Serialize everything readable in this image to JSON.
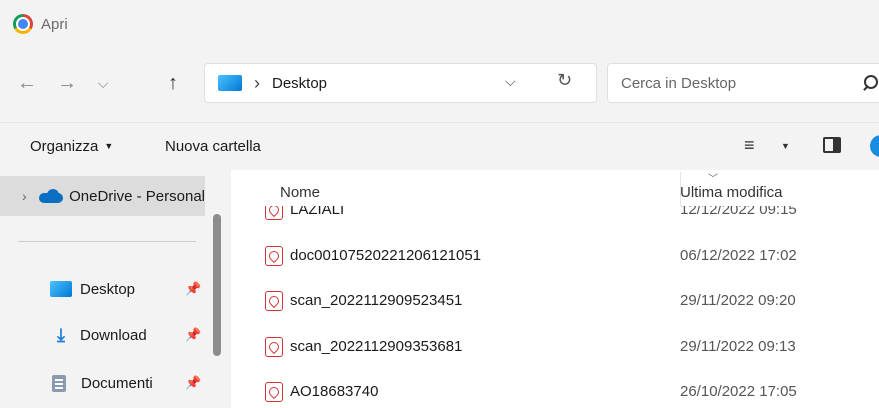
{
  "window": {
    "title": "Apri",
    "app_icon": "chrome-logo-icon"
  },
  "nav": {
    "back_icon": "arrow-left-icon",
    "forward_icon": "arrow-right-icon",
    "recent_icon": "chevron-down-icon",
    "up_icon": "arrow-up-icon"
  },
  "address": {
    "location_icon": "desktop-folder-icon",
    "separator": "›",
    "path": "Desktop",
    "dropdown_icon": "chevron-down-icon",
    "refresh_icon": "refresh-icon"
  },
  "search": {
    "placeholder": "Cerca in Desktop"
  },
  "toolbar": {
    "organize_label": "Organizza",
    "new_folder_label": "Nuova cartella",
    "view_icon": "view-details-icon",
    "preview_pane_icon": "preview-pane-icon"
  },
  "sidebar": {
    "onedrive_label": "OneDrive - Personal",
    "quick_access": [
      {
        "label": "Desktop",
        "icon": "desktop-folder-icon",
        "pinned": true
      },
      {
        "label": "Download",
        "icon": "download-icon",
        "pinned": true
      },
      {
        "label": "Documenti",
        "icon": "documents-icon",
        "pinned": true
      }
    ]
  },
  "columns": {
    "name": "Nome",
    "modified": "Ultima modifica"
  },
  "files": [
    {
      "name": "LAZIALI",
      "modified": "12/12/2022 09:15",
      "icon": "pdf-file-icon"
    },
    {
      "name": "doc00107520221206121051",
      "modified": "06/12/2022 17:02",
      "icon": "pdf-file-icon"
    },
    {
      "name": "scan_2022112909523451",
      "modified": "29/11/2022 09:20",
      "icon": "pdf-file-icon"
    },
    {
      "name": "scan_2022112909353681",
      "modified": "29/11/2022 09:13",
      "icon": "pdf-file-icon"
    },
    {
      "name": "AO18683740",
      "modified": "26/10/2022 17:05",
      "icon": "pdf-file-icon"
    }
  ],
  "colors": {
    "accent": "#0078d4",
    "pdf_red": "#d13438",
    "selection": "#dcdcdc"
  }
}
